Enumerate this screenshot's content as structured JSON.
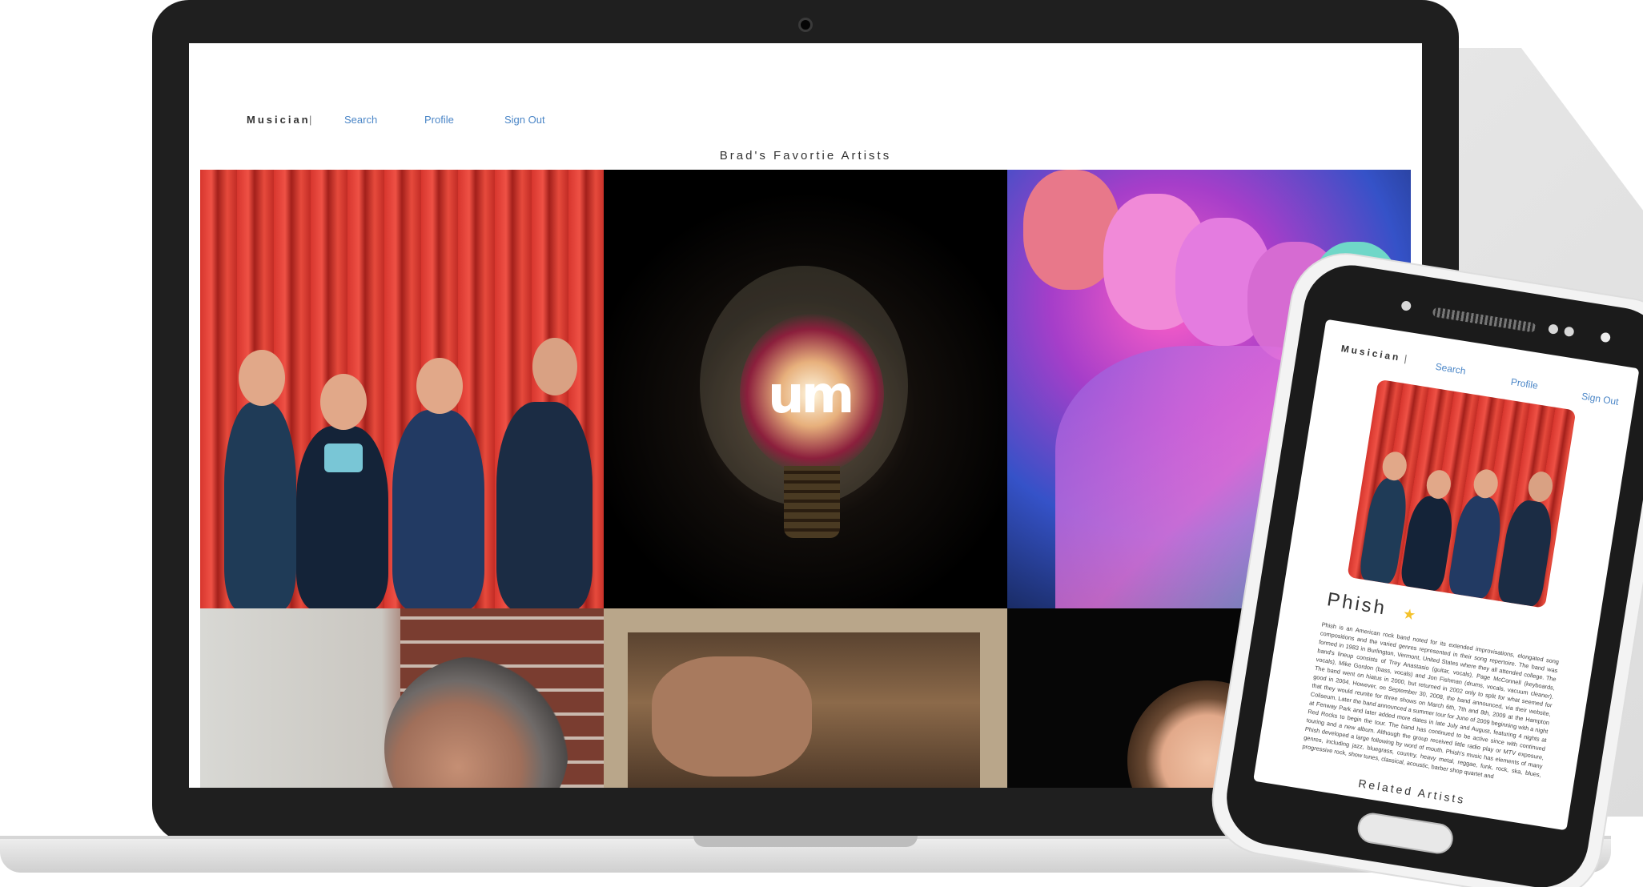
{
  "desktop": {
    "nav": {
      "brand": "Musician",
      "separator": "|",
      "search": "Search",
      "profile": "Profile",
      "sign_out": "Sign Out"
    },
    "page_title": "Brad's Favortie Artists",
    "tiles": [
      "phish-photo",
      "umphreys-mcgee-photo",
      "trey-anastasio-photo",
      "dave-matthews-photo",
      "woodworking-artist-photo",
      "jerry-garcia-photo"
    ]
  },
  "mobile": {
    "nav": {
      "brand": "Musician",
      "separator": "|",
      "search": "Search",
      "profile": "Profile",
      "sign_out": "Sign Out"
    },
    "artist_name": "Phish",
    "favorite_icon": "star-icon",
    "bio": "Phish is an American rock band noted for its extended improvisations, elongated song compositions and the varied genres represented in their song repertoire. The band was formed in 1983 in Burlington, Vermont, United States where they all attended college. The band's lineup consists of Trey Anastasio (guitar, vocals), Page McConnell (keyboards, vocals), Mike Gordon (bass, vocals) and Jon Fishman (drums, vocals, vacuum cleaner). The band went on hiatus in 2000, but returned in 2002 only to split for what seemed for good in 2004. However, on September 30, 2008, the band announced, via their website, that they would reunite for three shows on March 6th, 7th and 8th, 2009 at the Hampton Coliseum. Later the band announced a summer tour for June of 2009 beginning with a night at Fenway Park and later added more dates in late July and August, featuring 4 nights at Red Rocks to begin the tour. The band has continued to be active since with continued touring and a new album. Although the group received little radio play or MTV exposure, Phish developed a large following by word of mouth. Phish's music has elements of many genres, including jazz, bluegrass, country, heavy metal, reggae, funk, rock, ska, blues, progressive rock, show tunes, classical, acoustic, barber shop quartet and",
    "related_heading": "Related Artists"
  }
}
